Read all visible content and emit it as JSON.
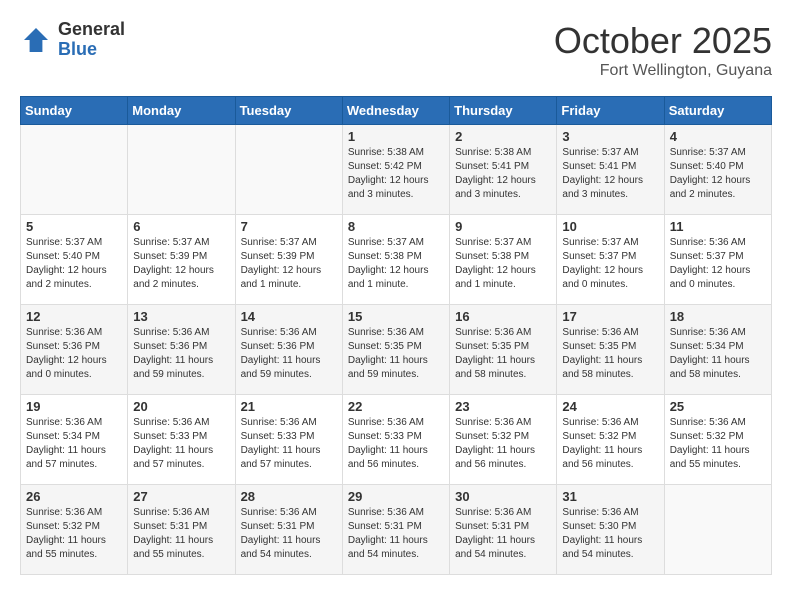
{
  "logo": {
    "general": "General",
    "blue": "Blue"
  },
  "title": "October 2025",
  "location": "Fort Wellington, Guyana",
  "days_header": [
    "Sunday",
    "Monday",
    "Tuesday",
    "Wednesday",
    "Thursday",
    "Friday",
    "Saturday"
  ],
  "weeks": [
    [
      {
        "num": "",
        "info": ""
      },
      {
        "num": "",
        "info": ""
      },
      {
        "num": "",
        "info": ""
      },
      {
        "num": "1",
        "info": "Sunrise: 5:38 AM\nSunset: 5:42 PM\nDaylight: 12 hours\nand 3 minutes."
      },
      {
        "num": "2",
        "info": "Sunrise: 5:38 AM\nSunset: 5:41 PM\nDaylight: 12 hours\nand 3 minutes."
      },
      {
        "num": "3",
        "info": "Sunrise: 5:37 AM\nSunset: 5:41 PM\nDaylight: 12 hours\nand 3 minutes."
      },
      {
        "num": "4",
        "info": "Sunrise: 5:37 AM\nSunset: 5:40 PM\nDaylight: 12 hours\nand 2 minutes."
      }
    ],
    [
      {
        "num": "5",
        "info": "Sunrise: 5:37 AM\nSunset: 5:40 PM\nDaylight: 12 hours\nand 2 minutes."
      },
      {
        "num": "6",
        "info": "Sunrise: 5:37 AM\nSunset: 5:39 PM\nDaylight: 12 hours\nand 2 minutes."
      },
      {
        "num": "7",
        "info": "Sunrise: 5:37 AM\nSunset: 5:39 PM\nDaylight: 12 hours\nand 1 minute."
      },
      {
        "num": "8",
        "info": "Sunrise: 5:37 AM\nSunset: 5:38 PM\nDaylight: 12 hours\nand 1 minute."
      },
      {
        "num": "9",
        "info": "Sunrise: 5:37 AM\nSunset: 5:38 PM\nDaylight: 12 hours\nand 1 minute."
      },
      {
        "num": "10",
        "info": "Sunrise: 5:37 AM\nSunset: 5:37 PM\nDaylight: 12 hours\nand 0 minutes."
      },
      {
        "num": "11",
        "info": "Sunrise: 5:36 AM\nSunset: 5:37 PM\nDaylight: 12 hours\nand 0 minutes."
      }
    ],
    [
      {
        "num": "12",
        "info": "Sunrise: 5:36 AM\nSunset: 5:36 PM\nDaylight: 12 hours\nand 0 minutes."
      },
      {
        "num": "13",
        "info": "Sunrise: 5:36 AM\nSunset: 5:36 PM\nDaylight: 11 hours\nand 59 minutes."
      },
      {
        "num": "14",
        "info": "Sunrise: 5:36 AM\nSunset: 5:36 PM\nDaylight: 11 hours\nand 59 minutes."
      },
      {
        "num": "15",
        "info": "Sunrise: 5:36 AM\nSunset: 5:35 PM\nDaylight: 11 hours\nand 59 minutes."
      },
      {
        "num": "16",
        "info": "Sunrise: 5:36 AM\nSunset: 5:35 PM\nDaylight: 11 hours\nand 58 minutes."
      },
      {
        "num": "17",
        "info": "Sunrise: 5:36 AM\nSunset: 5:35 PM\nDaylight: 11 hours\nand 58 minutes."
      },
      {
        "num": "18",
        "info": "Sunrise: 5:36 AM\nSunset: 5:34 PM\nDaylight: 11 hours\nand 58 minutes."
      }
    ],
    [
      {
        "num": "19",
        "info": "Sunrise: 5:36 AM\nSunset: 5:34 PM\nDaylight: 11 hours\nand 57 minutes."
      },
      {
        "num": "20",
        "info": "Sunrise: 5:36 AM\nSunset: 5:33 PM\nDaylight: 11 hours\nand 57 minutes."
      },
      {
        "num": "21",
        "info": "Sunrise: 5:36 AM\nSunset: 5:33 PM\nDaylight: 11 hours\nand 57 minutes."
      },
      {
        "num": "22",
        "info": "Sunrise: 5:36 AM\nSunset: 5:33 PM\nDaylight: 11 hours\nand 56 minutes."
      },
      {
        "num": "23",
        "info": "Sunrise: 5:36 AM\nSunset: 5:32 PM\nDaylight: 11 hours\nand 56 minutes."
      },
      {
        "num": "24",
        "info": "Sunrise: 5:36 AM\nSunset: 5:32 PM\nDaylight: 11 hours\nand 56 minutes."
      },
      {
        "num": "25",
        "info": "Sunrise: 5:36 AM\nSunset: 5:32 PM\nDaylight: 11 hours\nand 55 minutes."
      }
    ],
    [
      {
        "num": "26",
        "info": "Sunrise: 5:36 AM\nSunset: 5:32 PM\nDaylight: 11 hours\nand 55 minutes."
      },
      {
        "num": "27",
        "info": "Sunrise: 5:36 AM\nSunset: 5:31 PM\nDaylight: 11 hours\nand 55 minutes."
      },
      {
        "num": "28",
        "info": "Sunrise: 5:36 AM\nSunset: 5:31 PM\nDaylight: 11 hours\nand 54 minutes."
      },
      {
        "num": "29",
        "info": "Sunrise: 5:36 AM\nSunset: 5:31 PM\nDaylight: 11 hours\nand 54 minutes."
      },
      {
        "num": "30",
        "info": "Sunrise: 5:36 AM\nSunset: 5:31 PM\nDaylight: 11 hours\nand 54 minutes."
      },
      {
        "num": "31",
        "info": "Sunrise: 5:36 AM\nSunset: 5:30 PM\nDaylight: 11 hours\nand 54 minutes."
      },
      {
        "num": "",
        "info": ""
      }
    ]
  ]
}
